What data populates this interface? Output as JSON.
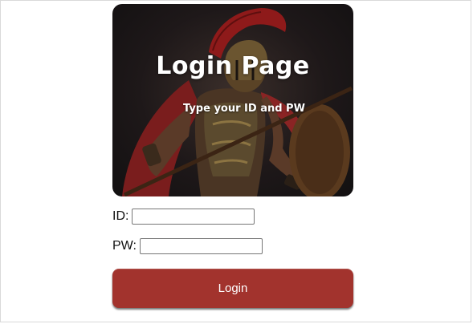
{
  "hero": {
    "title": "Login Page",
    "subtitle": "Type your ID and PW",
    "image_subject": "spartan-warrior-image"
  },
  "form": {
    "id_label": "ID:",
    "id_value": "",
    "pw_label": "PW:",
    "pw_value": "",
    "login_label": "Login"
  },
  "colors": {
    "button": "#a2332d",
    "button_text": "#ffffff",
    "background": "#ffffff"
  }
}
